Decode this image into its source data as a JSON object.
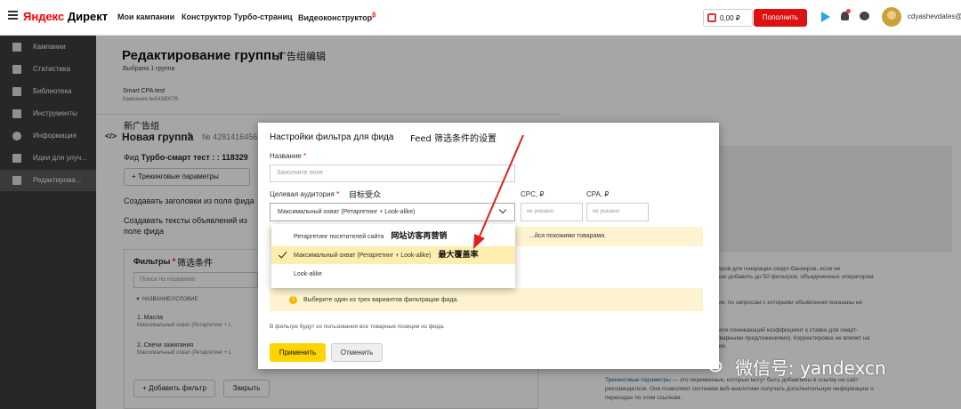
{
  "header": {
    "logo_ya": "Яндекс",
    "logo_rest": " Директ",
    "nav": [
      "Мои кампании",
      "Конструктор Турбо-страниц",
      "Видеоконструктор"
    ],
    "nav_badge": "β",
    "balance": "0,00 ₽",
    "topup_label": "Пополнить",
    "username": "cdyashevdates@"
  },
  "sidebar": {
    "items": [
      {
        "label": "Кампании",
        "icon": "campaigns-icon"
      },
      {
        "label": "Статистика",
        "icon": "chart-icon"
      },
      {
        "label": "Библиотека",
        "icon": "library-icon"
      },
      {
        "label": "Инструменты",
        "icon": "wrench-icon"
      },
      {
        "label": "Информация",
        "icon": "info-icon"
      },
      {
        "label": "Идеи для улуч...",
        "icon": "thumbs-up-icon"
      },
      {
        "label": "Редактирова...",
        "icon": "pencil-icon"
      }
    ]
  },
  "page": {
    "title": "Редактирование группы",
    "title_cn": "广告组编辑",
    "subline": "Выбрана 1 группа",
    "campaign": "Smart CPA test",
    "campaign_num": "Кампания №54380076",
    "group_cn": "新广告组",
    "group_name": "Новая группа",
    "group_id": "№ 4281416456",
    "feed_label": "Фид",
    "feed_value": "Турбо-смарт тест : : 118329",
    "tracking_btn": "+ Трекинговые параметры",
    "para1": "Создавать заголовки из поля фида",
    "para2": "Создавать тексты объявлений из поле фида"
  },
  "filters": {
    "title": "Фильтры",
    "title_cn": "筛选条件",
    "search_placeholder": "Поиск по названию",
    "col_head": "▼ НАЗВАНИЕ/УСЛОВИЕ",
    "items": [
      {
        "name": "1. Масла",
        "sub": "Максимальный охват (Ретаргетинг + L"
      },
      {
        "name": "2. Свечи зажигания",
        "sub": "Максимальный охват (Ретаргетинг + L"
      }
    ],
    "add_label": "+ Добавить фильтр",
    "close_label": "Закрыть"
  },
  "right_panel": {
    "lines": [
      "...йся похожими товарами.",
      "товаров для генерации смарт-баннеров, если не",
      "можно добавить до 50 фильтров, объединенных оператором",
      "тания, по запросам с которыми объявления показаны не",
      "ый или понижающий коэффициент к ставке для смарт-",
      "с товарными предложениями). Корректировка не влияет на",
      "вании."
    ],
    "link": "Трекинговые параметры",
    "link_rest": " — это переменные, которые могут быть добавлены в ссылку на сайт",
    "line2": "рекламодателя. Они позволяют системам веб-аналитики получать дополнительную информацию о",
    "line3": "переходах по этим ссылкам."
  },
  "modal": {
    "title": "Настройки фильтра для фида",
    "title_cn": "Feed 筛选条件的设置",
    "name_label": "Название",
    "name_placeholder": "Заполните поле",
    "aud_label": "Целевая аудитория",
    "aud_cn": "目标受众",
    "aud_value": "Максимальный охват (Ретаргетинг + Look-alike)",
    "cpc_label": "CPC, ₽",
    "cpa_label": "CPA, ₽",
    "cpc_placeholder": "не указано",
    "cpa_placeholder": "не указано",
    "yellow_text": "...йся похожими товарами.",
    "warn_text": "Выберите один из трех вариантов фильтрации фида.",
    "info_text": "В фильтре будут из пользования все товарные позиции из фида.",
    "apply_label": "Применить",
    "cancel_label": "Отменить"
  },
  "dropdown": {
    "options": [
      {
        "label": "Ретаргетинг посетителей сайта",
        "cn": "网站访客再营销"
      },
      {
        "label": "Максимальный охват (Ретаргетинг + Look-alike)",
        "cn": "最大覆盖率"
      },
      {
        "label": "Look-alike",
        "cn": ""
      }
    ],
    "selected_index": 1
  },
  "watermark": "微信号: yandexcn",
  "colors": {
    "accent_red": "#d11111",
    "accent_yellow": "#ffd400",
    "sidebar_bg": "#3c3c3c",
    "selected_bg": "#fdeeae",
    "annotation_red": "#e02020"
  }
}
